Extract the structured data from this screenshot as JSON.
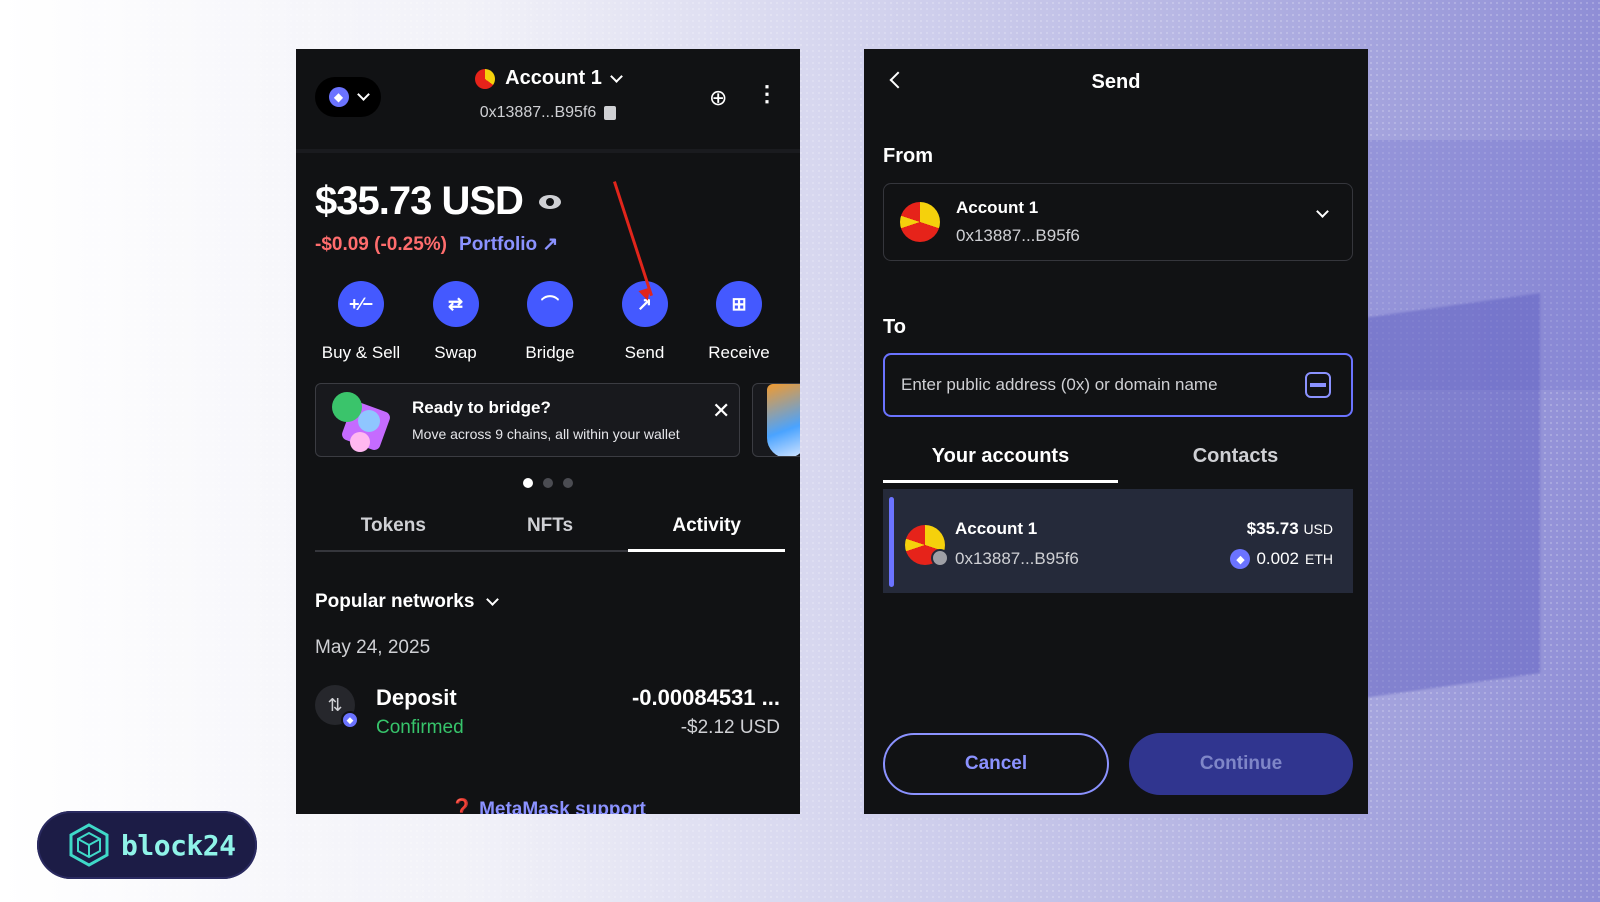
{
  "left_panel": {
    "network_selector": {
      "icon": "eth-icon"
    },
    "account": {
      "name": "Account 1",
      "address": "0x13887...B95f6"
    },
    "balance": {
      "amount": "$35.73 USD",
      "change": "-$0.09 (-0.25%)",
      "portfolio_label": "Portfolio"
    },
    "actions": [
      {
        "label": "Buy & Sell",
        "icon": "+∕−"
      },
      {
        "label": "Swap",
        "icon": "⇄"
      },
      {
        "label": "Bridge",
        "icon": "⌒"
      },
      {
        "label": "Send",
        "icon": "↗"
      },
      {
        "label": "Receive",
        "icon": "⊞"
      }
    ],
    "banner": {
      "title": "Ready to bridge?",
      "subtitle": "Move across 9 chains, all within your wallet"
    },
    "tabs": [
      {
        "label": "Tokens",
        "active": false
      },
      {
        "label": "NFTs",
        "active": false
      },
      {
        "label": "Activity",
        "active": true
      }
    ],
    "filter": {
      "label": "Popular networks"
    },
    "activity": {
      "date": "May 24, 2025",
      "items": [
        {
          "title": "Deposit",
          "status": "Confirmed",
          "amount": "-0.00084531 ...",
          "usd": "-$2.12 USD"
        }
      ]
    },
    "support_link": "MetaMask support"
  },
  "right_panel": {
    "title": "Send",
    "from_label": "From",
    "from_account": {
      "name": "Account 1",
      "address": "0x13887...B95f6"
    },
    "to_label": "To",
    "to_input": {
      "placeholder": "Enter public address (0x) or domain name",
      "value": ""
    },
    "tabs": [
      {
        "label": "Your accounts",
        "active": true
      },
      {
        "label": "Contacts",
        "active": false
      }
    ],
    "accounts": [
      {
        "name": "Account 1",
        "address": "0x13887...B95f6",
        "usd_value": "$35.73",
        "usd_unit": "USD",
        "eth_value": "0.002",
        "eth_unit": "ETH"
      }
    ],
    "buttons": {
      "cancel": "Cancel",
      "continue": "Continue"
    }
  },
  "logo": {
    "text": "block24"
  },
  "colors": {
    "accent": "#4459ff",
    "link": "#8b92ff",
    "negative": "#ff6d6d",
    "success": "#37c46b",
    "panel_bg": "#111214"
  }
}
